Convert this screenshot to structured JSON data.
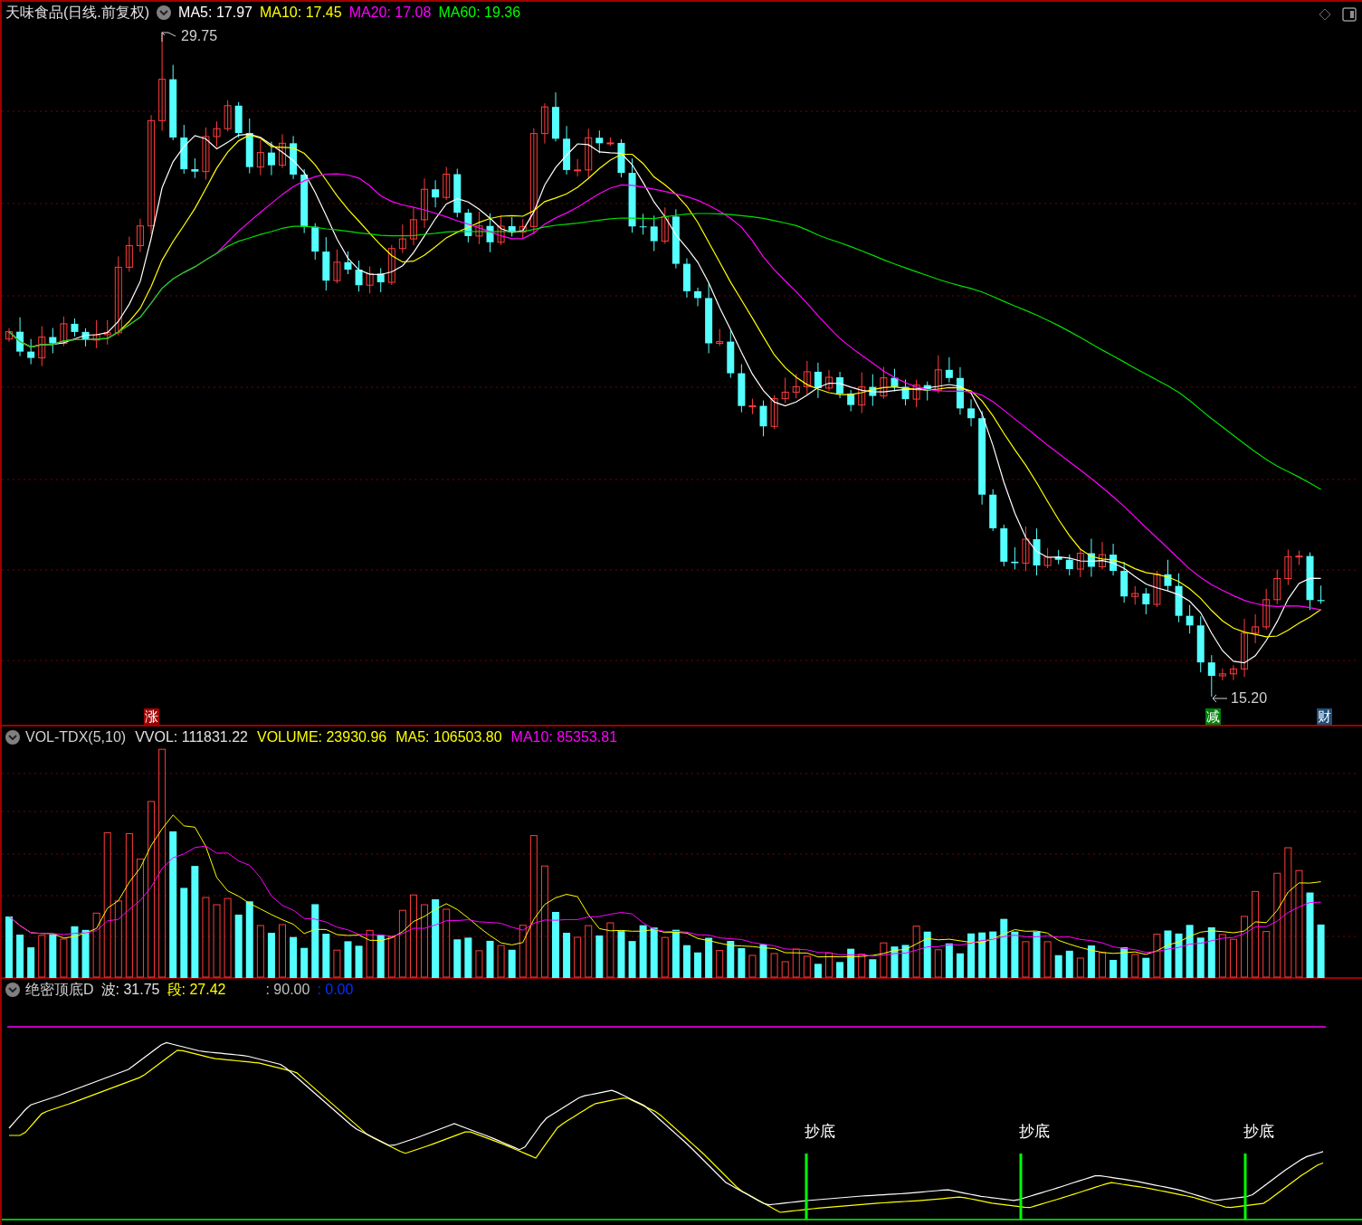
{
  "title": "天味食品(日线.前复权)",
  "price_panel": {
    "averages": [
      {
        "label": "MA5: 17.97",
        "color": "#ffffff"
      },
      {
        "label": "MA10: 17.45",
        "color": "#ffff00"
      },
      {
        "label": "MA20: 17.08",
        "color": "#ff00ff"
      },
      {
        "label": "MA60: 19.36",
        "color": "#00ff00"
      }
    ],
    "high_label": "29.75",
    "low_label": "15.20",
    "markers": [
      {
        "text": "涨",
        "color": "#a00000"
      },
      {
        "text": "减",
        "color": "#00800a"
      },
      {
        "text": "财",
        "color": "#1e4f7a"
      }
    ]
  },
  "volume_panel": {
    "name": "VOL-TDX(5,10)",
    "values": [
      {
        "label": "VVOL: 111831.22",
        "color": "#e0e0e0"
      },
      {
        "label": "VOLUME: 23930.96",
        "color": "#ffff00"
      },
      {
        "label": "MA5: 106503.80",
        "color": "#ffff00"
      },
      {
        "label": "MA10: 85353.81",
        "color": "#ff00ff"
      }
    ]
  },
  "indicator_panel": {
    "name": "绝密顶底D",
    "values": [
      {
        "label": "波: 31.75",
        "color": "#e0e0e0"
      },
      {
        "label": "段: 27.42",
        "color": "#ffff00"
      },
      {
        "label": ": 90.00",
        "color": "#c0c0c0"
      },
      {
        "label": ": 0.00",
        "color": "#0030ff"
      }
    ],
    "signals": [
      "抄底",
      "抄底",
      "抄底"
    ]
  }
}
